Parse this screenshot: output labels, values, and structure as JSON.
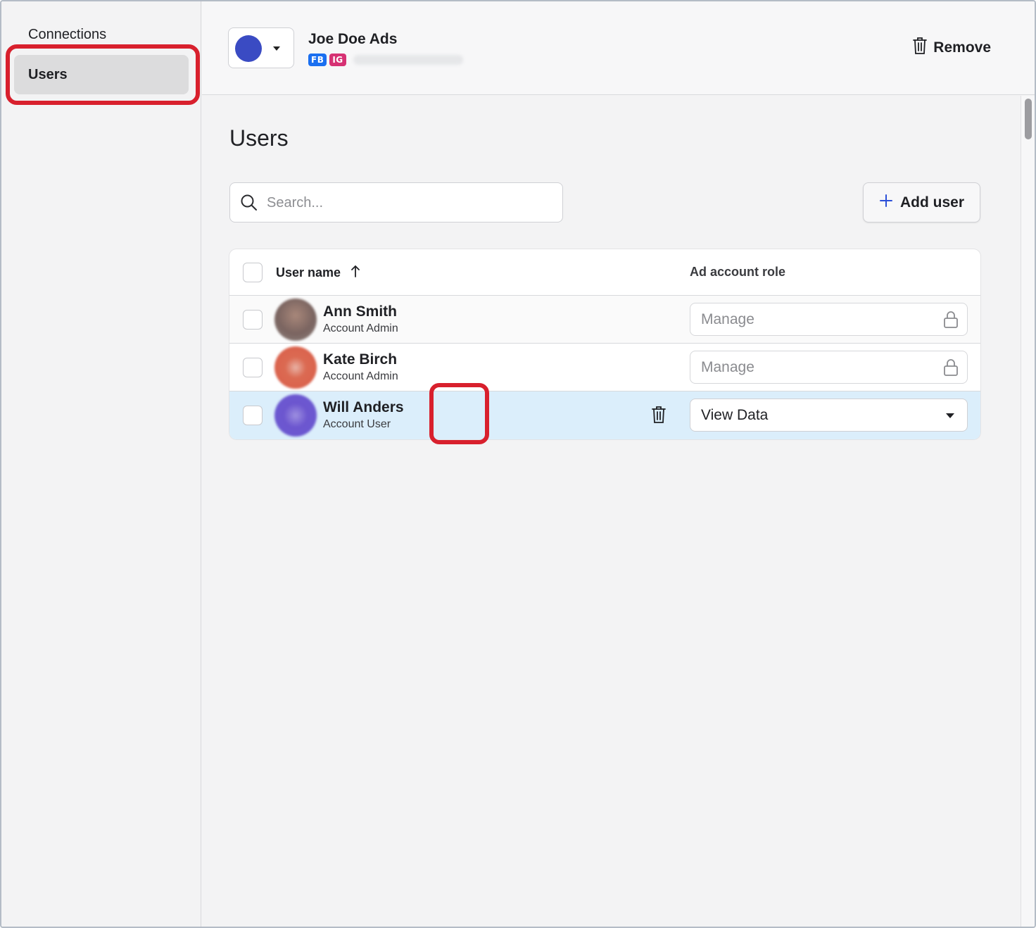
{
  "sidebar": {
    "items": [
      {
        "label": "Connections"
      },
      {
        "label": "Users"
      }
    ]
  },
  "header": {
    "account_name": "Joe Doe Ads",
    "badges": [
      "FB",
      "IG"
    ],
    "remove_label": "Remove",
    "account_color": "#3a4bc3"
  },
  "main": {
    "title": "Users",
    "search": {
      "placeholder": "Search...",
      "value": ""
    },
    "add_user_label": "Add user"
  },
  "table": {
    "columns": {
      "user_name": "User name",
      "role": "Ad account role"
    },
    "rows": [
      {
        "name": "Ann Smith",
        "account_role": "Account Admin",
        "ad_role": "Manage",
        "locked": true
      },
      {
        "name": "Kate Birch",
        "account_role": "Account Admin",
        "ad_role": "Manage",
        "locked": true
      },
      {
        "name": "Will Anders",
        "account_role": "Account User",
        "ad_role": "View Data",
        "locked": false
      }
    ]
  },
  "colors": {
    "highlight_row": "#dbeefb",
    "annotation": "#d8202d",
    "fb_badge": "#1a6ff0",
    "ig_badge": "#d63173"
  }
}
